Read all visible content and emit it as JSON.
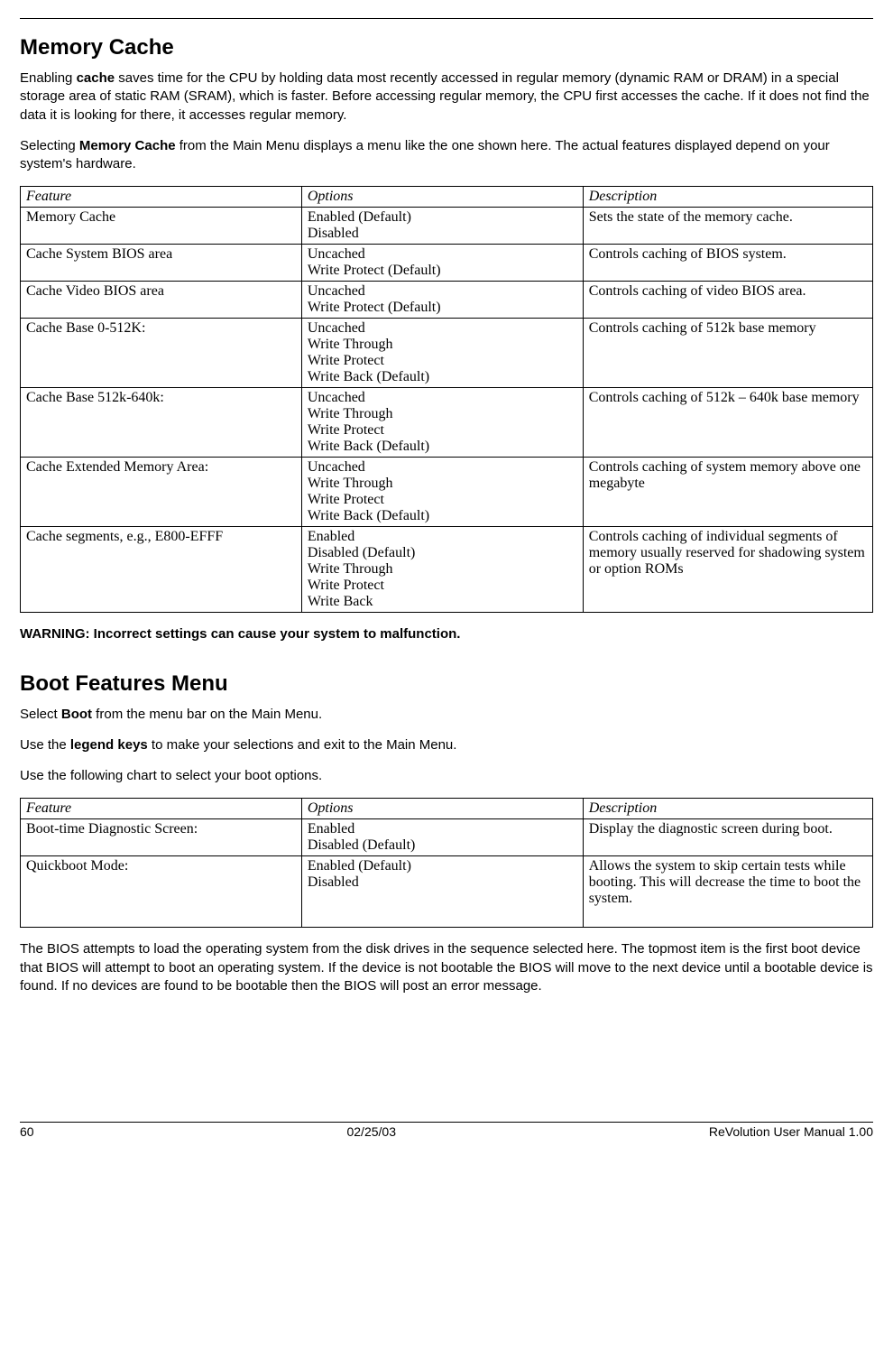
{
  "header": {
    "title1": "Memory Cache",
    "intro1a": "Enabling ",
    "intro1b_bold": "cache",
    "intro1c": " saves time for the CPU by holding data most recently accessed in regular memory (dynamic RAM or DRAM) in a special storage area of static RAM (SRAM), which is faster. Before accessing regular memory, the CPU first accesses the cache. If it does not find the data it is looking for there, it accesses regular memory.",
    "intro2a": "Selecting ",
    "intro2b_bold": "Memory Cache",
    "intro2c": " from the Main Menu displays a menu like the one shown here. The actual features displayed depend on your system's hardware."
  },
  "table1": {
    "headers": [
      "Feature",
      "Options",
      "Description"
    ],
    "rows": [
      {
        "feature": "Memory Cache",
        "options": [
          "Enabled (Default)",
          "Disabled"
        ],
        "desc": "Sets the state of the memory cache."
      },
      {
        "feature": "Cache System BIOS area",
        "options": [
          "Uncached",
          "Write Protect (Default)"
        ],
        "desc": "Controls caching of BIOS system."
      },
      {
        "feature": "Cache Video BIOS area",
        "options": [
          "Uncached",
          "Write Protect (Default)"
        ],
        "desc": "Controls caching of video BIOS area."
      },
      {
        "feature": "Cache Base 0-512K:",
        "options": [
          "Uncached",
          "Write Through",
          "Write Protect",
          "Write Back (Default)"
        ],
        "desc": "Controls caching of 512k base memory"
      },
      {
        "feature": "Cache Base 512k-640k:",
        "options": [
          "Uncached",
          "Write Through",
          "Write Protect",
          "Write Back (Default)"
        ],
        "desc": "Controls caching of 512k – 640k base memory"
      },
      {
        "feature": "Cache Extended Memory Area:",
        "options": [
          "Uncached",
          "Write Through",
          "Write Protect",
          "Write Back (Default)"
        ],
        "desc": "Controls caching of system memory above one megabyte"
      },
      {
        "feature": "Cache segments, e.g., E800-EFFF",
        "options": [
          "Enabled",
          "Disabled (Default)",
          "Write Through",
          "Write Protect",
          "Write Back"
        ],
        "desc": "Controls caching of individual segments of memory usually reserved for shadowing system or option ROMs"
      }
    ]
  },
  "warning": "WARNING: Incorrect settings can cause your system to malfunction.",
  "section2": {
    "title": "Boot Features Menu",
    "p1a": "Select ",
    "p1b_bold": "Boot",
    "p1c": " from the menu bar on the Main Menu.",
    "p2a": "Use the ",
    "p2b_bold": "legend keys",
    "p2c": " to make your selections and exit to the Main Menu.",
    "p3": "Use the following chart to select your boot options."
  },
  "table2": {
    "headers": [
      "Feature",
      "Options",
      "Description"
    ],
    "rows": [
      {
        "feature": "Boot-time Diagnostic Screen:",
        "options": [
          "Enabled",
          "Disabled (Default)"
        ],
        "desc": "Display the diagnostic screen during boot."
      },
      {
        "feature": "Quickboot Mode:",
        "options": [
          "Enabled (Default)",
          "Disabled"
        ],
        "desc": "Allows the system to skip certain tests while booting. This will decrease the time to boot the system.",
        "extra_pad": true
      }
    ]
  },
  "closing": "The BIOS attempts to load the operating system from the disk drives in the sequence selected here. The topmost item is the first boot device that BIOS will attempt to boot an operating system. If the device is not bootable the BIOS will move to the next device until a bootable device is found. If no devices are found to be bootable then the BIOS will post an error message.",
  "footer": {
    "left": "60",
    "center": "02/25/03",
    "right": "ReVolution User Manual 1.00"
  }
}
